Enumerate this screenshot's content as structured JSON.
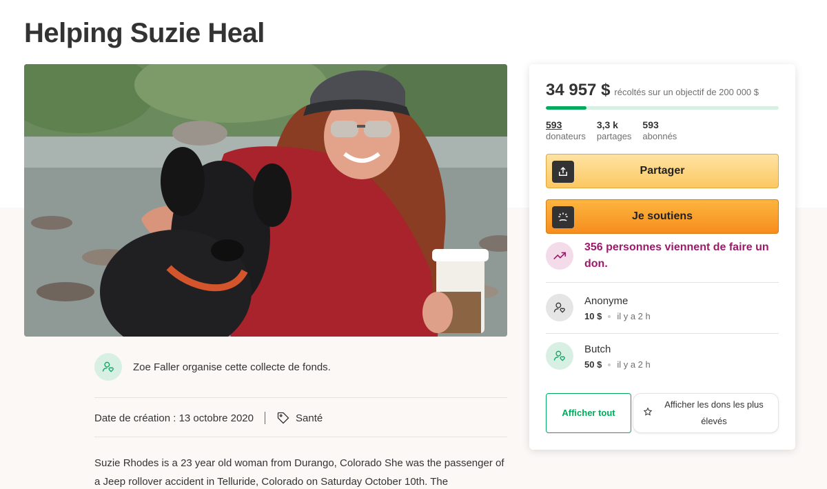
{
  "page": {
    "title": "Helping Suzie Heal"
  },
  "organizer": {
    "text": "Zoe Faller organise cette collecte de fonds."
  },
  "meta": {
    "created": "Date de création : 13 octobre 2020",
    "category": "Santé"
  },
  "story": {
    "text": "Suzie Rhodes is a 23 year old woman from Durango, Colorado  She was the passenger of a Jeep rollover accident in Telluride, Colorado on Saturday October 10th. The"
  },
  "sidebar": {
    "raised": "34 957 $",
    "goal_text": "récoltés sur un objectif de 200 000 $",
    "progress_fraction": 0.175,
    "stats": [
      {
        "value": "593",
        "label": "donateurs"
      },
      {
        "value": "3,3 k",
        "label": "partages"
      },
      {
        "value": "593",
        "label": "abonnés"
      }
    ],
    "share_label": "Partager",
    "donate_label": "Je soutiens",
    "trend_text": "356 personnes viennent de faire un don.",
    "donors": [
      {
        "name": "Anonyme",
        "amount": "10 $",
        "time": "il y a 2 h",
        "avatar_bg": "#e5e5e5"
      },
      {
        "name": "Butch",
        "amount": "50 $",
        "time": "il y a 2 h",
        "avatar_bg": "#d8f0e4"
      }
    ],
    "show_all_label": "Afficher tout",
    "show_top_label": "Afficher les dons les plus élevés"
  },
  "colors": {
    "accent_green": "#02a95c",
    "trend_purple": "#9c1a6a",
    "share_yellow": "#fbc862",
    "donate_orange": "#f78d1e"
  },
  "icons": {
    "organizer": "user-heart-icon",
    "category": "tag-icon",
    "share": "share-upload-icon",
    "donate": "hand-heart-icon",
    "trend": "trending-up-icon",
    "donor": "user-heart-icon",
    "top_donations": "star-icon"
  }
}
